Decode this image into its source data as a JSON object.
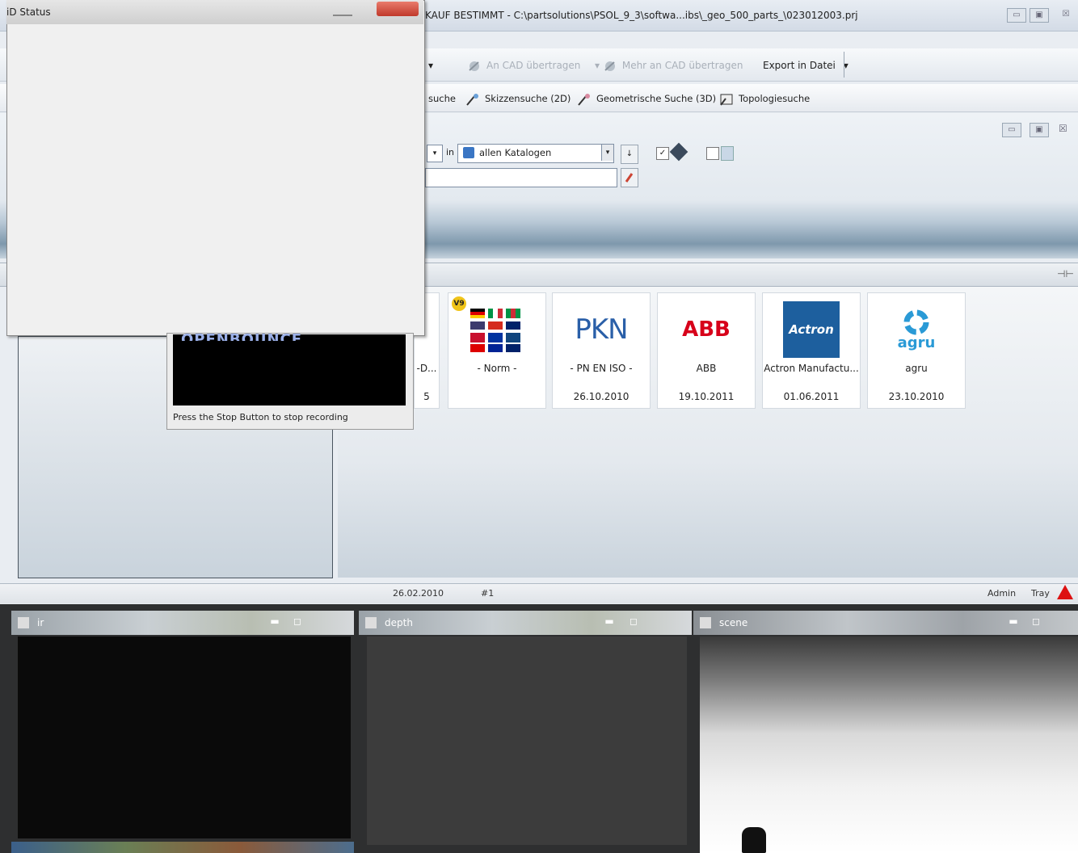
{
  "status_window": {
    "title": "iD Status"
  },
  "main_window": {
    "title": "KAUF BESTIMMT - C:\\partsolutions\\PSOL_9_3\\softwa...ibs\\_geo_500_parts_\\023012003.prj",
    "controls": {
      "minimize": "▭",
      "maximize": "▣",
      "close": "☒"
    }
  },
  "toolbar": {
    "dropdown_arrow": "▾",
    "to_cad": "An CAD übertragen",
    "multi_to_cad": "Mehr an CAD übertragen",
    "export": "Export in Datei",
    "export_arrow": "▾"
  },
  "search_tabs": {
    "fulltext": "suche",
    "sketch": "Skizzensuche (2D)",
    "geometric": "Geometrische Suche (3D)",
    "topology": "Topologiesuche"
  },
  "search_panel": {
    "in_label": "in",
    "catalog_value": "allen Katalogen",
    "search_value": ""
  },
  "catalogs": [
    {
      "name": "-D...",
      "date": "5"
    },
    {
      "name": "- Norm -",
      "date": "",
      "badge": "V9"
    },
    {
      "name": "- PN EN ISO -",
      "date": "26.10.2010",
      "logo_text": "PKN"
    },
    {
      "name": "ABB",
      "date": "19.10.2011",
      "logo_text": "ABB"
    },
    {
      "name": "Actron Manufactu...",
      "date": "01.06.2011",
      "logo_text": "Actron"
    },
    {
      "name": "agru",
      "date": "23.10.2010",
      "logo_text": "agru"
    }
  ],
  "statusbar": {
    "date": "26.02.2010",
    "number": "#1",
    "user": "Admin",
    "mode": "Tray"
  },
  "recorder": {
    "hint": "Press the Stop Button to stop recording",
    "screen_text": "OPENBOUNCE"
  },
  "bottom_windows": [
    {
      "title": "ir"
    },
    {
      "title": "depth"
    },
    {
      "title": "scene"
    }
  ],
  "colors": {
    "accent": "#1f5fa8",
    "abb_red": "#d7001a",
    "actron_blue": "#1d5f9e",
    "agru_blue": "#2a9ad6"
  }
}
